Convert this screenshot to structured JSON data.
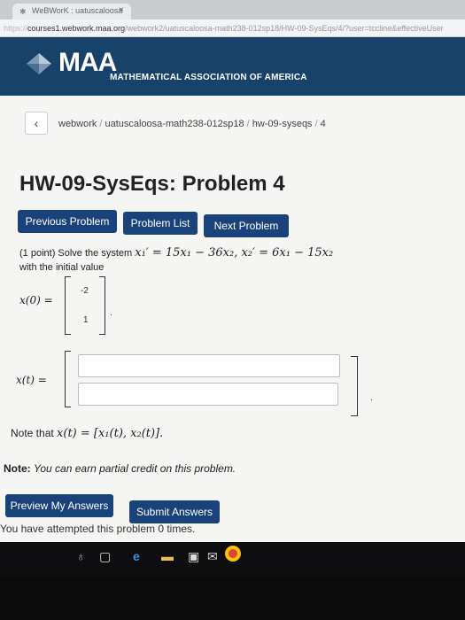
{
  "browser": {
    "tab_title": "WeBWorK : uatuscaloosa",
    "tab_close": "×",
    "url_scheme": "https://",
    "url_host": "courses1.webwork.maa.org",
    "url_path": "/webwork2/uatuscaloosa-math238-012sp18/HW-09-SysEqs/4/?user=tccline&effectiveUser"
  },
  "header": {
    "logo": "MAA",
    "subtitle": "MATHEMATICAL ASSOCIATION OF AMERICA",
    "brand_color": "#17436b"
  },
  "breadcrumb": {
    "back": "‹",
    "items": [
      "webwork",
      "uatuscaloosa-math238-012sp18",
      "hw-09-syseqs",
      "4"
    ],
    "separator": "/"
  },
  "page": {
    "title": "HW-09-SysEqs: Problem 4"
  },
  "nav_buttons": {
    "previous": "Previous Problem",
    "list": "Problem List",
    "next": "Next Problem"
  },
  "problem": {
    "points": "(1 point) Solve the system",
    "system": "x₁′ = 15x₁ − 36x₂,   x₂′ = 6x₁ − 15x₂",
    "initial_label": "with the initial value",
    "x0_label": "x(0) =",
    "x0_values": [
      "-2",
      "1"
    ],
    "period": ".",
    "xt_label": "x(t) =",
    "xt_period": ".",
    "answer_1": "",
    "answer_2": "",
    "note_prefix": "Note that",
    "note_math": "x(t) = [x₁(t), x₂(t)]."
  },
  "partial_credit": {
    "label": "Note:",
    "text": "You can earn partial credit on this problem."
  },
  "submit_buttons": {
    "preview": "Preview My Answers",
    "submit": "Submit Answers"
  },
  "attempts": "You have attempted this problem 0 times."
}
